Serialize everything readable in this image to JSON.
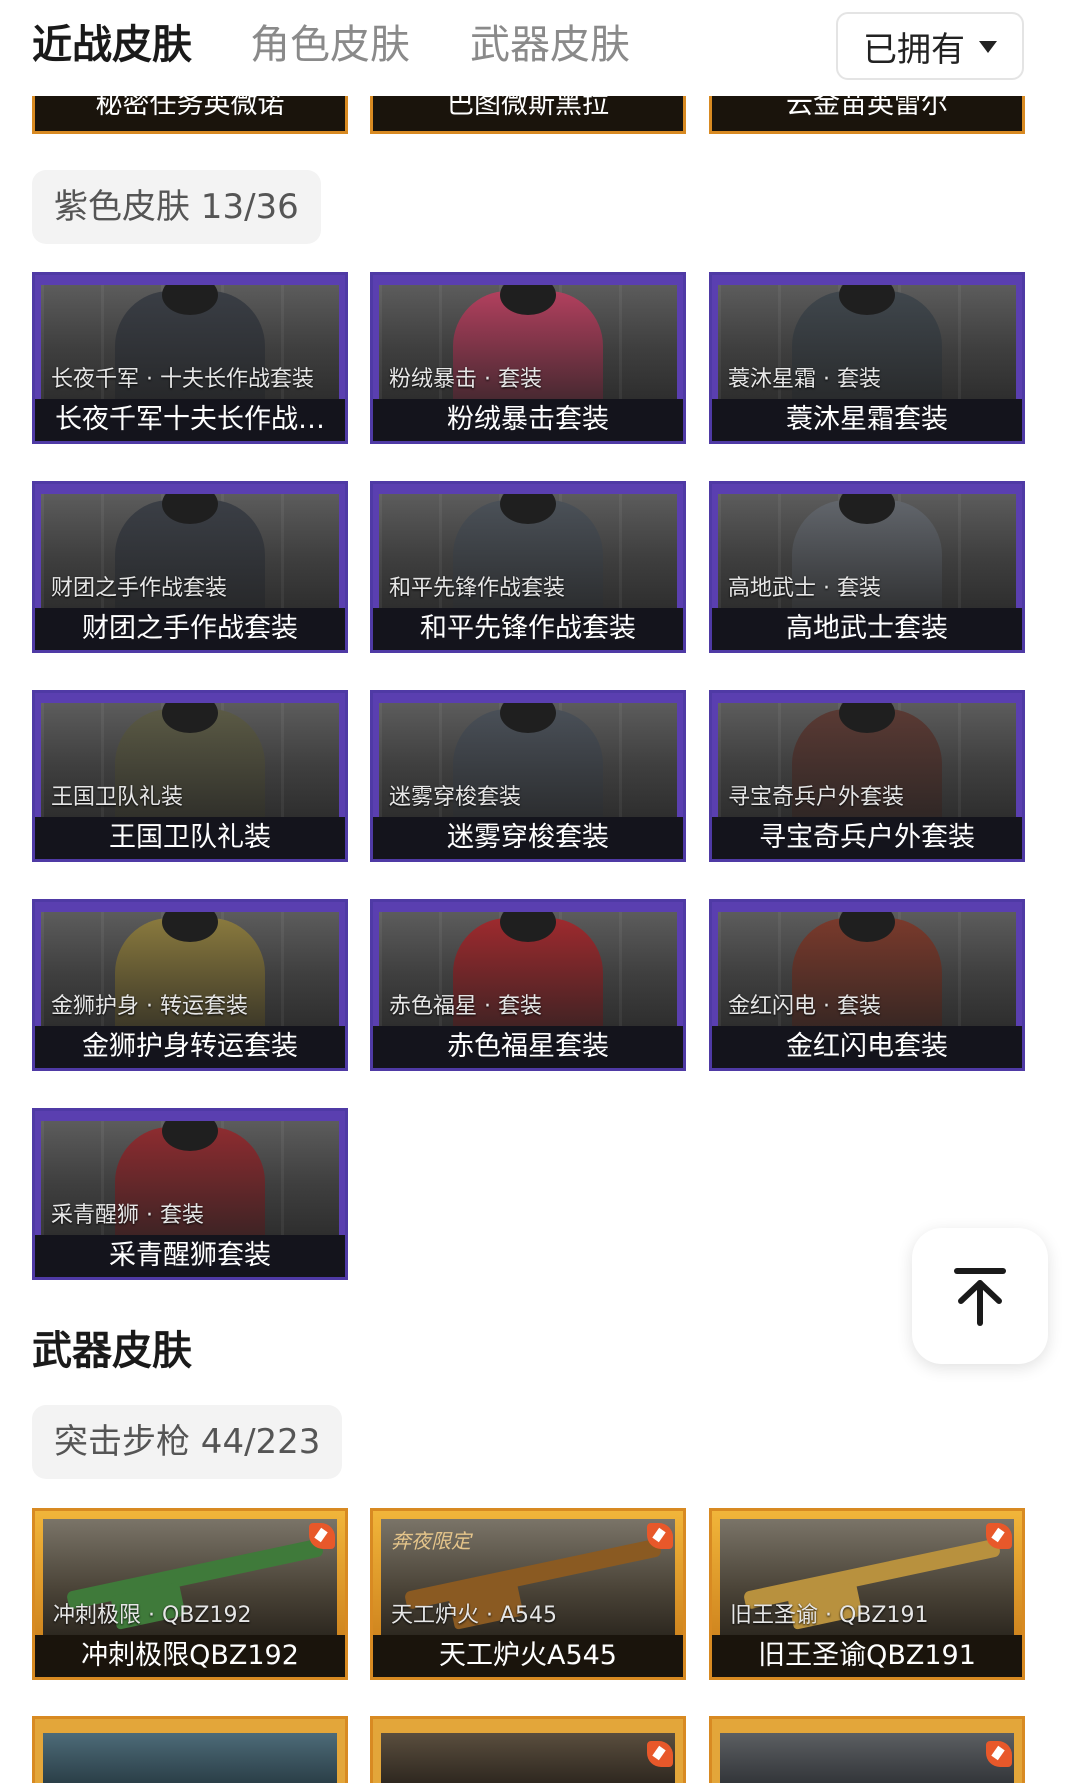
{
  "tabs": [
    {
      "label": "近战皮肤",
      "active": true
    },
    {
      "label": "角色皮肤",
      "active": false
    },
    {
      "label": "武器皮肤",
      "active": false
    }
  ],
  "filter": {
    "label": "已拥有"
  },
  "top_partial_cards": [
    {
      "name": "秘密任务英微诺"
    },
    {
      "name": "巴图微斯黑拉"
    },
    {
      "name": "云金苗英雷尔"
    }
  ],
  "purple_section": {
    "label": "紫色皮肤 13/36",
    "cards": [
      {
        "sub": "长夜千军 · 十夫长作战套装",
        "name": "长夜千军十夫长作战…",
        "color": "#3a3e45"
      },
      {
        "sub": "粉绒暴击 · 套装",
        "name": "粉绒暴击套装",
        "color": "#b2405e"
      },
      {
        "sub": "蓑沐星霜 · 套装",
        "name": "蓑沐星霜套装",
        "color": "#40474d"
      },
      {
        "sub": "财团之手作战套装",
        "name": "财团之手作战套装",
        "color": "#3b3f46"
      },
      {
        "sub": "和平先锋作战套装",
        "name": "和平先锋作战套装",
        "color": "#4b5158"
      },
      {
        "sub": "高地武士 · 套装",
        "name": "高地武士套装",
        "color": "#62666c"
      },
      {
        "sub": "王国卫队礼装",
        "name": "王国卫队礼装",
        "color": "#5b5a45"
      },
      {
        "sub": "迷雾穿梭套装",
        "name": "迷雾穿梭套装",
        "color": "#4a5058"
      },
      {
        "sub": "寻宝奇兵户外套装",
        "name": "寻宝奇兵户外套装",
        "color": "#5a3a34"
      },
      {
        "sub": "金狮护身 · 转运套装",
        "name": "金狮护身转运套装",
        "color": "#8a7a3e"
      },
      {
        "sub": "赤色福星 · 套装",
        "name": "赤色福星套装",
        "color": "#9e2a2e"
      },
      {
        "sub": "金红闪电 · 套装",
        "name": "金红闪电套装",
        "color": "#7a3a2c"
      },
      {
        "sub": "采青醒狮 · 套装",
        "name": "采青醒狮套装",
        "color": "#8e2c30"
      }
    ]
  },
  "weapon_section": {
    "title": "武器皮肤",
    "label": "突击步枪 44/223",
    "cards": [
      {
        "sub": "冲刺极限 · QBZ192",
        "name": "冲刺极限QBZ192",
        "color": "#3f7a3a",
        "stamp": ""
      },
      {
        "sub": "天工炉火 · A545",
        "name": "天工炉火A545",
        "color": "#8a5a22",
        "stamp": "奔夜限定"
      },
      {
        "sub": "旧王圣谕 · QBZ191",
        "name": "旧王圣谕QBZ191",
        "color": "#b8913e",
        "stamp": ""
      }
    ]
  },
  "colors": {
    "purple_frame": "#5a3fb0",
    "gold_frame": "#d88a22",
    "name_bar": "#14141c"
  },
  "icons": {
    "filter_caret": "caret-down-icon",
    "scroll_top": "arrow-up-to-top-icon",
    "corner": "paint-brush-icon"
  }
}
